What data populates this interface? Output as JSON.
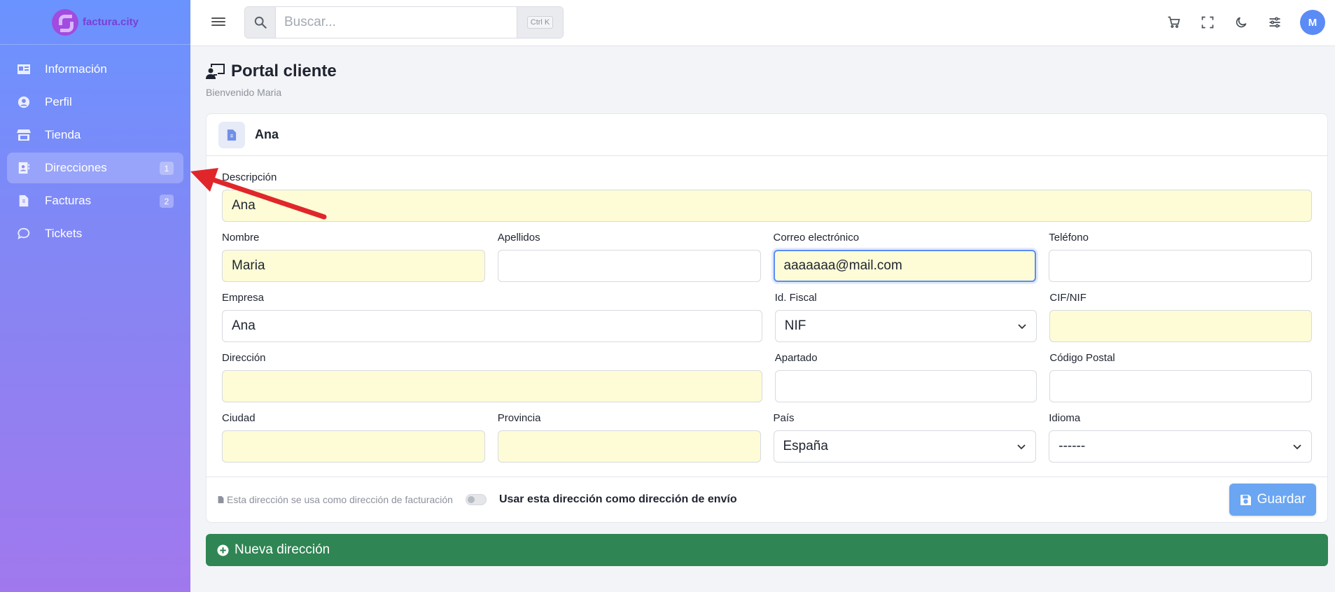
{
  "brand": {
    "name": "factura.city"
  },
  "sidebar": {
    "items": [
      {
        "label": "Información",
        "icon": "id-card-icon",
        "badge": ""
      },
      {
        "label": "Perfil",
        "icon": "user-circle-icon",
        "badge": ""
      },
      {
        "label": "Tienda",
        "icon": "store-icon",
        "badge": ""
      },
      {
        "label": "Direcciones",
        "icon": "address-book-icon",
        "badge": "1",
        "active": true
      },
      {
        "label": "Facturas",
        "icon": "invoice-icon",
        "badge": "2"
      },
      {
        "label": "Tickets",
        "icon": "chat-icon",
        "badge": ""
      }
    ]
  },
  "topbar": {
    "search_placeholder": "Buscar...",
    "search_shortcut": "Ctrl K",
    "icons": [
      "cart-icon",
      "fullscreen-icon",
      "moon-icon",
      "sliders-icon"
    ],
    "avatar_initial": "M"
  },
  "page": {
    "title": "Portal cliente",
    "subtitle": "Bienvenido Maria"
  },
  "card": {
    "title": "Ana",
    "fields": {
      "descripcion": {
        "label": "Descripción",
        "value": "Ana"
      },
      "nombre": {
        "label": "Nombre",
        "value": "Maria"
      },
      "apellidos": {
        "label": "Apellidos",
        "value": ""
      },
      "correo": {
        "label": "Correo electrónico",
        "value": "aaaaaaa@mail.com"
      },
      "telefono": {
        "label": "Teléfono",
        "value": ""
      },
      "empresa": {
        "label": "Empresa",
        "value": "Ana"
      },
      "id_fiscal": {
        "label": "Id. Fiscal",
        "value": "NIF"
      },
      "cif_nif": {
        "label": "CIF/NIF",
        "value": ""
      },
      "direccion": {
        "label": "Dirección",
        "value": ""
      },
      "apartado": {
        "label": "Apartado",
        "value": ""
      },
      "codigo_postal": {
        "label": "Código Postal",
        "value": ""
      },
      "ciudad": {
        "label": "Ciudad",
        "value": ""
      },
      "provincia": {
        "label": "Provincia",
        "value": ""
      },
      "pais": {
        "label": "País",
        "value": "España"
      },
      "idioma": {
        "label": "Idioma",
        "value": "------"
      }
    },
    "footer_note": "Esta dirección se usa como dirección de facturación",
    "shipping_toggle_label": "Usar esta dirección como dirección de envío",
    "save_label": "Guardar"
  },
  "new_address_label": "Nueva dirección",
  "colors": {
    "accent": "#5b8bf5",
    "required_field": "#fdfcd6",
    "success": "#2f8553",
    "annotation_arrow": "#e0262a"
  }
}
